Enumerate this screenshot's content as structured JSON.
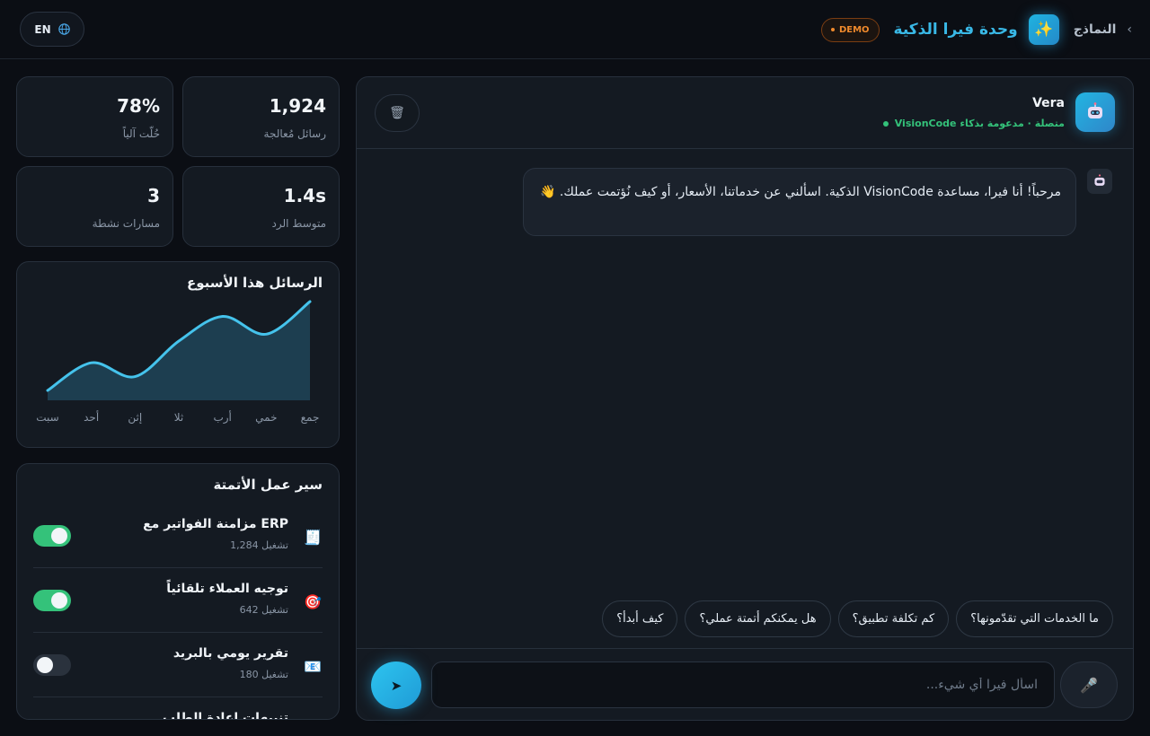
{
  "header": {
    "lang_label": "EN",
    "breadcrumb": "النماذج",
    "title": "وحدة فيرا الذكية",
    "badge": "DEMO"
  },
  "stats": [
    {
      "value": "1,924",
      "label": "رسائل مُعالجة"
    },
    {
      "value": "78%",
      "label": "حُلّت آلياً"
    },
    {
      "value": "1.4s",
      "label": "متوسط الرد"
    },
    {
      "value": "3",
      "label": "مسارات نشطة"
    }
  ],
  "chart": {
    "title": "الرسائل هذا الأسبوع",
    "fill_color": "#1d3e50",
    "line_color": "#45c3ec"
  },
  "chart_data": {
    "type": "area",
    "title": "الرسائل هذا الأسبوع",
    "categories": [
      "سبت",
      "أحد",
      "إثن",
      "ثلا",
      "أرب",
      "خمي",
      "جمع"
    ],
    "values": [
      10,
      38,
      24,
      60,
      85,
      67,
      100
    ],
    "ylim": [
      0,
      100
    ],
    "grid": false
  },
  "workflows": {
    "title": "سير عمل الأتمتة",
    "items": [
      {
        "name": "مزامنة الفواتير مع ERP",
        "runs": "1,284 تشغيل",
        "icon": "🧾",
        "enabled": true
      },
      {
        "name": "توجيه العملاء تلقائياً",
        "runs": "642 تشغيل",
        "icon": "🎯",
        "enabled": true
      },
      {
        "name": "تقرير يومي بالبريد",
        "runs": "180 تشغيل",
        "icon": "📧",
        "enabled": false
      },
      {
        "name": "تنبيهات إعادة الطلب",
        "runs": "",
        "icon": "📦",
        "enabled": true
      }
    ]
  },
  "chat": {
    "bot_name": "Vera",
    "status": "متصلة · مدعومة بذكاء VisionCode",
    "welcome": "مرحباً! أنا فيرا، مساعدة VisionCode الذكية. اسألني عن خدماتنا، الأسعار، أو كيف نُؤتمت عملك. 👋",
    "suggestions": [
      "ما الخدمات التي تقدّمونها؟",
      "كم تكلفة تطبيق؟",
      "هل يمكنكم أتمتة عملي؟",
      "كيف أبدأ؟"
    ],
    "input_placeholder": "اسأل فيرا أي شيء..."
  },
  "colors": {
    "accent": "#39b8e6",
    "success": "#34c27a",
    "demo": "#f08a2c"
  }
}
